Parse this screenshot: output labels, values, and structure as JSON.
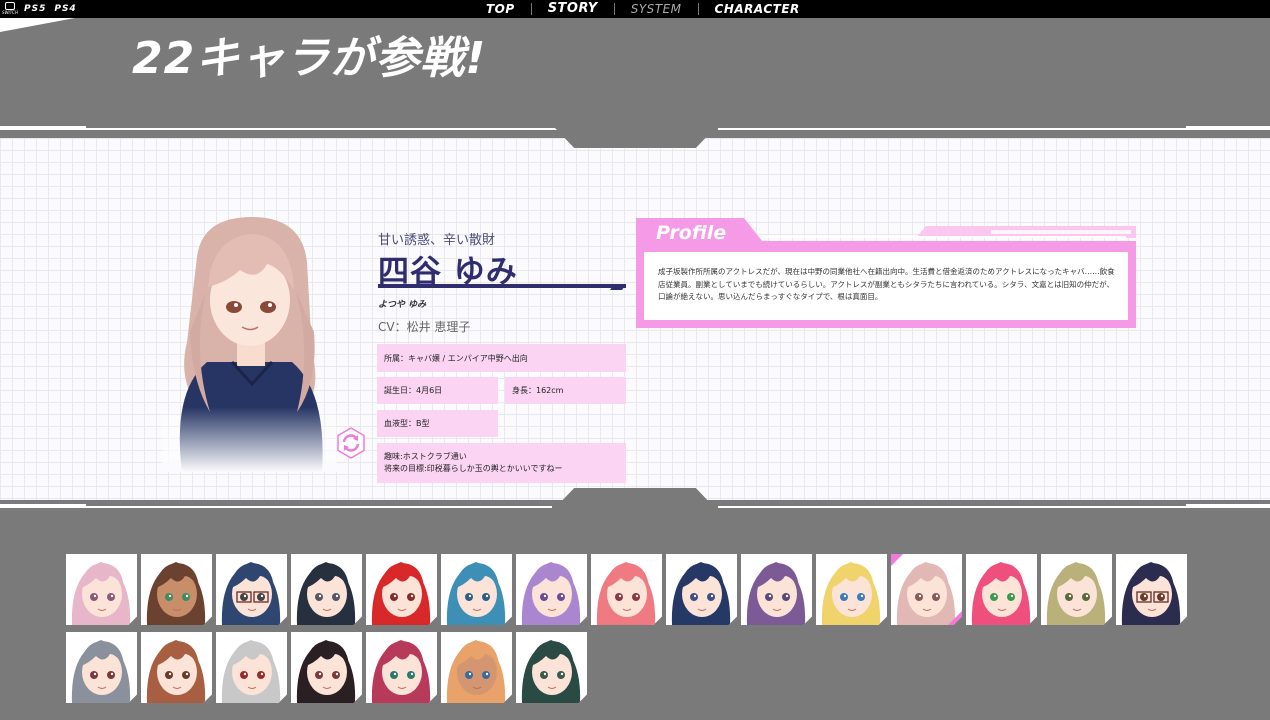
{
  "platforms": {
    "switch": "SWITCH",
    "ps5": "PS5",
    "ps4": "PS4"
  },
  "nav": [
    {
      "label": "TOP"
    },
    {
      "label": "STORY"
    },
    {
      "label": "SYSTEM"
    },
    {
      "label": "CHARACTER"
    }
  ],
  "page_title": "22キャラが参戦!",
  "character": {
    "catchphrase": "甘い誘惑、辛い散財",
    "name": "四谷 ゆみ",
    "reading": "よつや ゆみ",
    "cv": "CV：松井 恵理子",
    "affiliation": "所属：キャバ嬢 / エンパイア中野へ出向",
    "birthday": "誕生日：4月6日",
    "height": "身長：162cm",
    "blood_type": "血液型：B型",
    "hobby": "趣味:ホストクラブ通い",
    "goal": "将来の目標:印税暮らしか玉の輿とかいいですねー"
  },
  "profile": {
    "label": "Profile",
    "text": "成子坂製作所所属のアクトレスだが、現在は中野の同業他社へ在籍出向中。生活費と借金返済のためアクトレスになったキャバ……飲食店従業員。副業としていまでも続けているらしい。アクトレスが副業ともシタラたちに言われている。シタラ、文嘉とは旧知の仲だが、口論が絶えない。思い込んだらまっすぐなタイプで、根は真面目。"
  },
  "colors": {
    "accent_pink": "#f59ae6",
    "field_pink": "#fbd4f4",
    "name_navy": "#2f2d6e",
    "background_gray": "#7a7a7a"
  },
  "icons": {
    "refresh": "refresh-icon",
    "switch": "switch-logo-icon"
  },
  "characters_row1": [
    {
      "hair": "#e7b7c9",
      "eye": "#8b5a7a",
      "skin": "#fbe3d8"
    },
    {
      "hair": "#6b4130",
      "eye": "#3f8b5e",
      "skin": "#c88d69"
    },
    {
      "hair": "#2f4770",
      "eye": "#444444",
      "skin": "#fbe3d8",
      "glasses": true
    },
    {
      "hair": "#26303f",
      "eye": "#555566",
      "skin": "#fbe3d8"
    },
    {
      "hair": "#d8282a",
      "eye": "#8a2a2a",
      "skin": "#fbe3d8"
    },
    {
      "hair": "#3e8fb6",
      "eye": "#2c5e8a",
      "skin": "#fbe3d8"
    },
    {
      "hair": "#a986cf",
      "eye": "#6a4b9a",
      "skin": "#fbe3d8"
    },
    {
      "hair": "#f07a82",
      "eye": "#8a3a44",
      "skin": "#fbe3d8"
    },
    {
      "hair": "#263966",
      "eye": "#3b4d8a",
      "skin": "#fbe3d8"
    },
    {
      "hair": "#7b5a95",
      "eye": "#5a4a7a",
      "skin": "#fbe3d8"
    },
    {
      "hair": "#f0d36a",
      "eye": "#3b7ac0",
      "skin": "#fbe3d8"
    },
    {
      "hair": "#e2b8b4",
      "eye": "#8a5a5a",
      "skin": "#fbe3d8",
      "selected": true
    },
    {
      "hair": "#ee4f7c",
      "eye": "#3a9a4a",
      "skin": "#fbe3d8"
    },
    {
      "hair": "#b9b07a",
      "eye": "#5a6a3a",
      "skin": "#fbe3d8"
    },
    {
      "hair": "#2b2c4e",
      "eye": "#6a3a2a",
      "skin": "#fbe3d8",
      "glasses": true
    }
  ],
  "characters_row2": [
    {
      "hair": "#8a909c",
      "eye": "#7a3a3a",
      "skin": "#fbe3d8"
    },
    {
      "hair": "#a85e40",
      "eye": "#6a3a2a",
      "skin": "#fbe3d8"
    },
    {
      "hair": "#c8c8c8",
      "eye": "#9a2a2a",
      "skin": "#fbe3d8"
    },
    {
      "hair": "#2a2024",
      "eye": "#7a3a3a",
      "skin": "#fbe3d8"
    },
    {
      "hair": "#b83a5a",
      "eye": "#2a7a6a",
      "skin": "#fbe3d8"
    },
    {
      "hair": "#e8a26a",
      "eye": "#3a6aa0",
      "skin": "#d49670"
    },
    {
      "hair": "#2a4a44",
      "eye": "#3a5a4a",
      "skin": "#fbe3d8"
    }
  ]
}
